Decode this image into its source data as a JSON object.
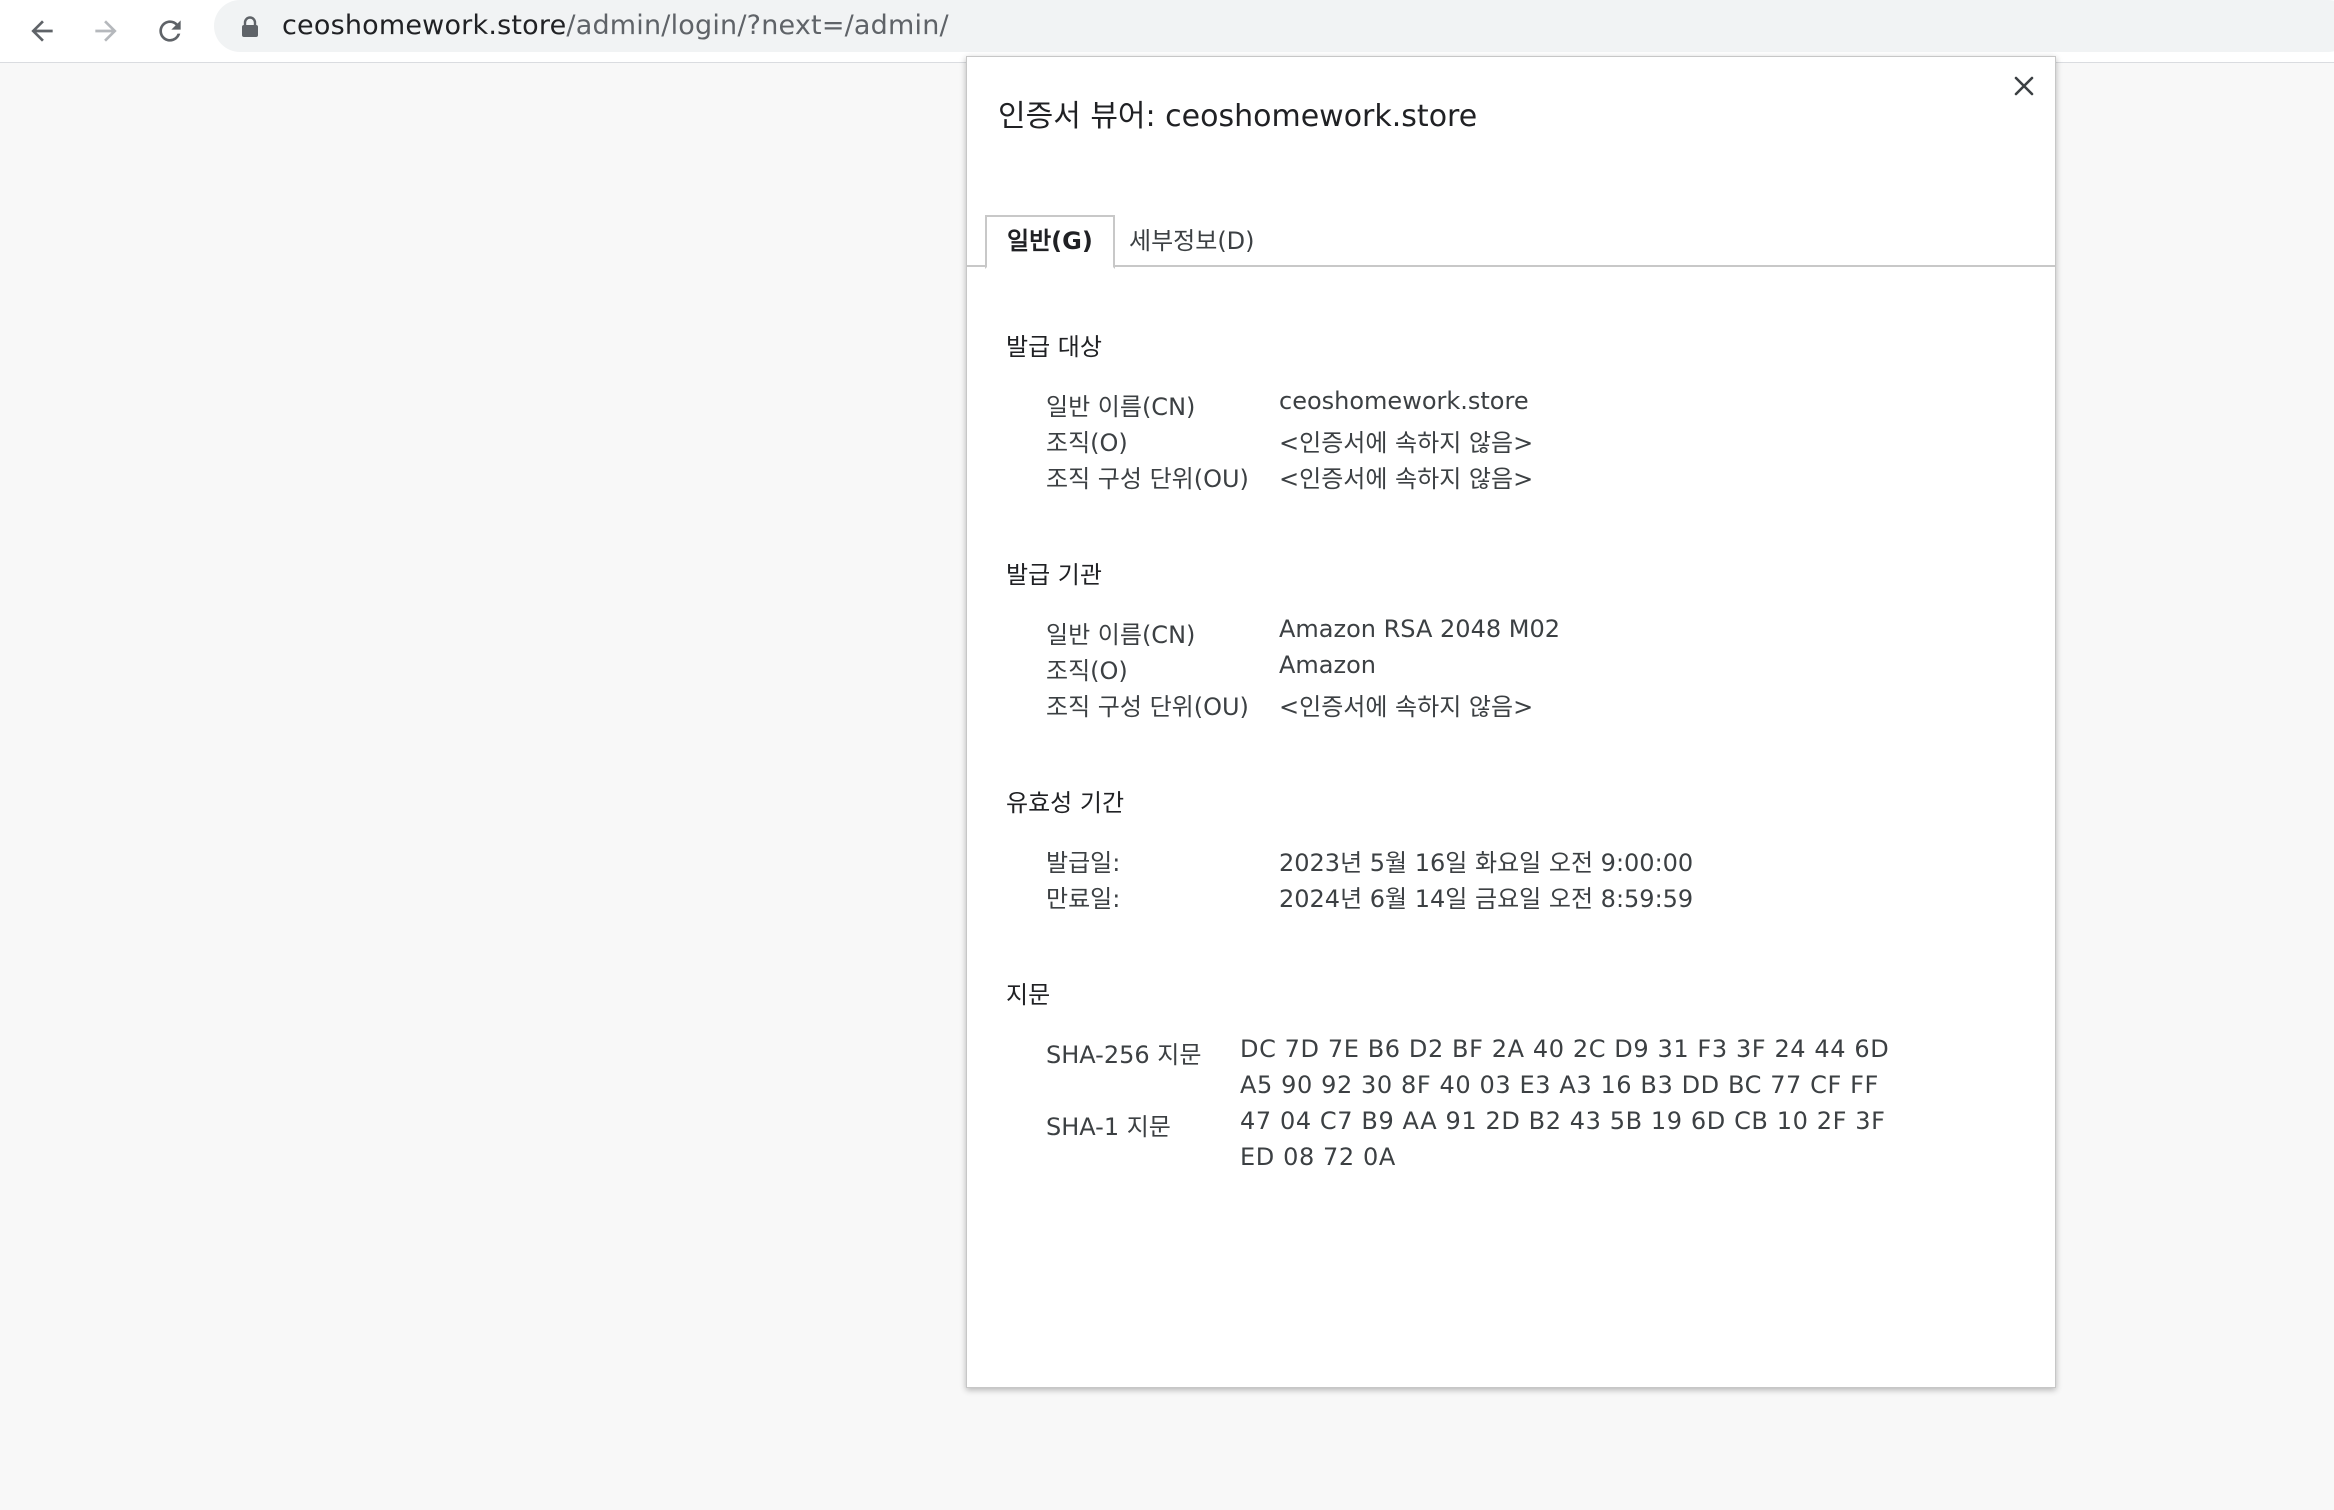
{
  "browser": {
    "url_host": "ceoshomework.store",
    "url_path": "/admin/login/?next=/admin/",
    "icons": {
      "back": "arrow-left-icon",
      "forward": "arrow-right-icon",
      "reload": "reload-icon",
      "lock": "lock-icon"
    }
  },
  "dialog": {
    "title": "인증서 뷰어: ceoshomework.store",
    "close_icon": "close-icon",
    "tabs": [
      {
        "label": "일반(G)",
        "selected": true
      },
      {
        "label": "세부정보(D)",
        "selected": false
      }
    ],
    "issued_to": {
      "heading": "발급 대상",
      "rows": [
        {
          "key": "일반 이름(CN)",
          "value": "ceoshomework.store"
        },
        {
          "key": "조직(O)",
          "value": "<인증서에 속하지 않음>"
        },
        {
          "key": "조직 구성 단위(OU)",
          "value": "<인증서에 속하지 않음>"
        }
      ]
    },
    "issued_by": {
      "heading": "발급 기관",
      "rows": [
        {
          "key": "일반 이름(CN)",
          "value": "Amazon RSA 2048 M02"
        },
        {
          "key": "조직(O)",
          "value": "Amazon"
        },
        {
          "key": "조직 구성 단위(OU)",
          "value": "<인증서에 속하지 않음>"
        }
      ]
    },
    "validity": {
      "heading": "유효성 기간",
      "rows": [
        {
          "key": "발급일:",
          "value": "2023년 5월 16일 화요일 오전 9:00:00"
        },
        {
          "key": "만료일:",
          "value": "2024년 6월 14일 금요일 오전 8:59:59"
        }
      ]
    },
    "fingerprints": {
      "heading": "지문",
      "sha256_label": "SHA-256 지문",
      "sha256_line1": "DC 7D 7E B6 D2 BF 2A 40 2C D9 31 F3 3F 24 44 6D",
      "sha256_line2": "A5 90 92 30 8F 40 03 E3 A3 16 B3 DD BC 77 CF FF",
      "sha1_label": "SHA-1 지문",
      "sha1_line1": "47 04 C7 B9 AA 91 2D B2 43 5B 19 6D CB 10 2F 3F",
      "sha1_line2": "ED 08 72 0A"
    }
  }
}
